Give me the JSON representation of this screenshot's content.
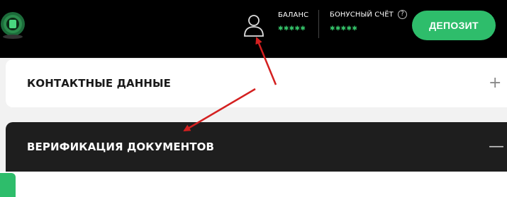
{
  "header": {
    "balance_label": "БАЛАНС",
    "balance_value": "✱✱✱✱✱",
    "bonus_label": "БОНУСНЫЙ СЧЁТ",
    "bonus_value": "✱✱✱✱✱",
    "help_glyph": "?",
    "deposit_label": "ДЕПОЗИТ",
    "icons": [
      "logo-icon",
      "user-icon",
      "help-icon"
    ]
  },
  "sections": [
    {
      "title": "КОНТАКТНЫЕ ДАННЫЕ",
      "toggle": "+"
    },
    {
      "title": "ВЕРИФИКАЦИЯ ДОКУМЕНТОВ",
      "toggle": "—"
    }
  ],
  "colors": {
    "accent": "#2ebd6b",
    "header_bg": "#000000",
    "annotation_arrow": "#d42020"
  }
}
